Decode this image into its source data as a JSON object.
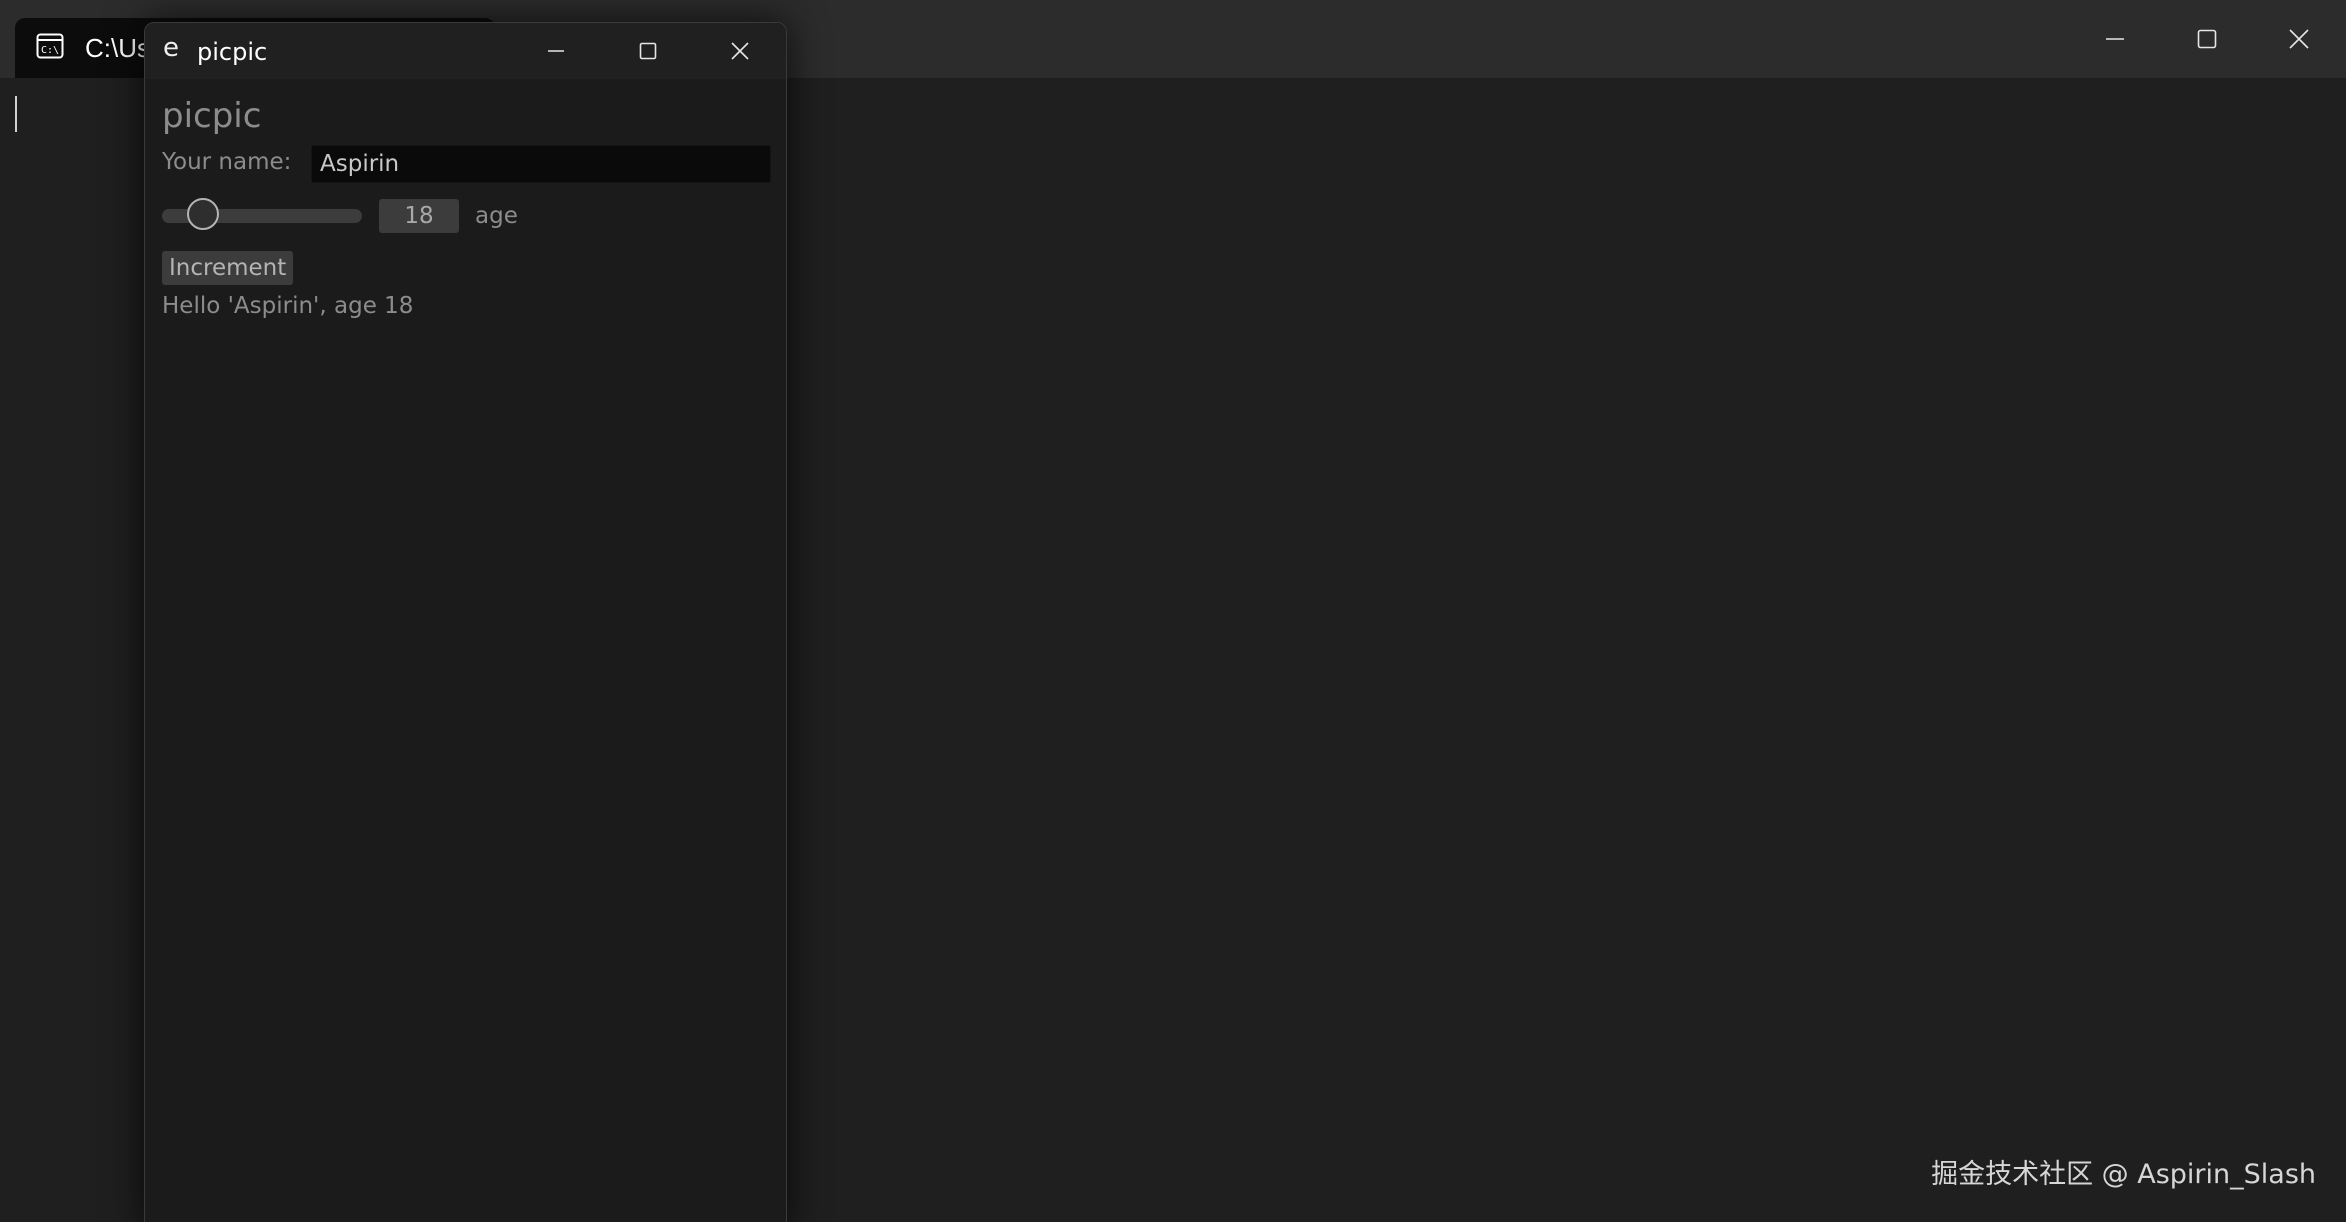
{
  "terminal": {
    "tab_title": "C:\\Us",
    "tab_icon": "terminal-icon",
    "captions": [
      "minimize-icon",
      "maximize-icon",
      "close-icon"
    ]
  },
  "app_window": {
    "icon_glyph": "e",
    "title": "picpic",
    "captions": [
      "minimize-icon",
      "maximize-icon",
      "close-icon"
    ]
  },
  "app": {
    "heading": "picpic",
    "name_label": "Your name:",
    "name_value": "Aspirin",
    "age_value": "18",
    "age_label": "age",
    "age_slider": {
      "value": 18,
      "min": 0,
      "max": 120
    },
    "increment_label": "Increment",
    "greeting": "Hello 'Aspirin', age 18"
  },
  "watermark": "掘金技术社区 @ Aspirin_Slash",
  "colors": {
    "terminal_bg": "#1f1f1f",
    "terminal_titlebar": "#2c2c2c",
    "app_bg": "#1b1b1b",
    "widget_bg": "#3c3c3c",
    "text_muted": "#8c8c8c"
  }
}
